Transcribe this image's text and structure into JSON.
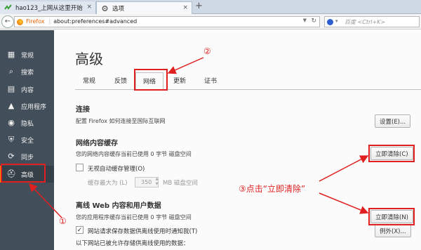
{
  "browser": {
    "tabs": [
      {
        "label": "hao123_上网从这里开始",
        "icon": "hao123-icon"
      },
      {
        "label": "选项",
        "icon": "gear-icon"
      }
    ],
    "new_tab": "+",
    "url_identity": "Firefox",
    "url": "about:preferences#advanced",
    "search_placeholder": "百度 <Ctrl+K>"
  },
  "sidebar": {
    "items": [
      {
        "label": "常规",
        "icon": "general-icon"
      },
      {
        "label": "搜索",
        "icon": "search-icon"
      },
      {
        "label": "内容",
        "icon": "content-icon"
      },
      {
        "label": "应用程序",
        "icon": "applications-icon"
      },
      {
        "label": "隐私",
        "icon": "privacy-mask-icon"
      },
      {
        "label": "安全",
        "icon": "security-shield-icon"
      },
      {
        "label": "同步",
        "icon": "sync-icon"
      },
      {
        "label": "高级",
        "icon": "advanced-hat-icon",
        "active": true
      }
    ]
  },
  "main": {
    "title": "高级",
    "subtabs": [
      "常规",
      "反馈",
      "网络",
      "更新",
      "证书"
    ],
    "active_subtab": "网络",
    "connection": {
      "title": "连接",
      "desc": "配置 Firefox 如何连接至国际互联网",
      "button": "设置(E)..."
    },
    "cache": {
      "title": "网络内容缓存",
      "desc": "您的网络内容缓存当前已使用 0 字节 磁盘空间",
      "button": "立即清除(C)",
      "override_label": "无视自动缓存管理(O)",
      "limit_label": "缓存最大为 (L)",
      "limit_value": "350",
      "limit_unit": "MB 磁盘空间"
    },
    "offline": {
      "title": "离线 Web 内容和用户数据",
      "desc": "您的应用程序缓存当前已使用 0 字节 磁盘空间",
      "button": "立即清除(N)",
      "notify_label": "网站请求保存数据供离线使用时通知我(T)",
      "exceptions_button": "例外(X)...",
      "list_label": "以下网站已被允许存储供离线使用的数据："
    }
  },
  "annotations": {
    "step1": "①",
    "step2": "②",
    "step3": "③点击“立即清除”",
    "color": "#e02020"
  }
}
